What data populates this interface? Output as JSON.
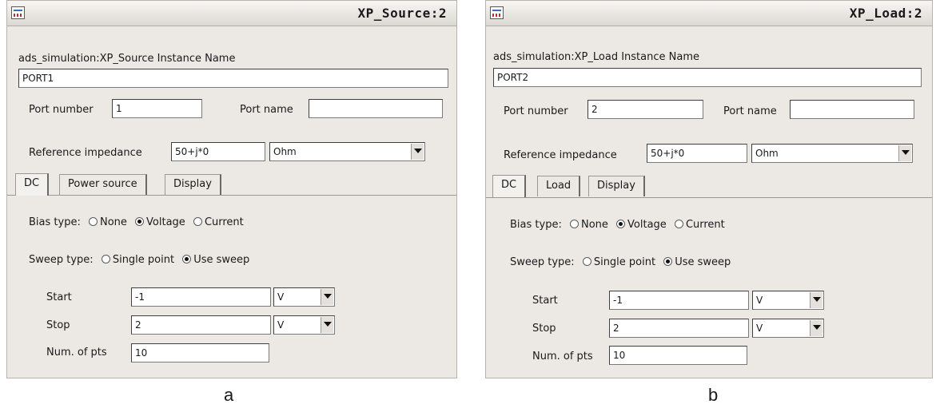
{
  "panel_a": {
    "title": "XP_Source:2",
    "instance_label": "ads_simulation:XP_Source Instance Name",
    "instance_value": "PORT1",
    "port_number_label": "Port number",
    "port_number_value": "1",
    "port_name_label": "Port name",
    "port_name_value": "",
    "ref_impedance_label": "Reference impedance",
    "ref_impedance_value": "50+j*0",
    "ref_impedance_unit": "Ohm",
    "tabs": [
      "DC",
      "Power source",
      "Display"
    ],
    "bias_label": "Bias type:",
    "bias_options": [
      "None",
      "Voltage",
      "Current"
    ],
    "sweep_label": "Sweep type:",
    "sweep_options": [
      "Single point",
      "Use sweep"
    ],
    "start_label": "Start",
    "start_value": "-1",
    "start_unit": "V",
    "stop_label": "Stop",
    "stop_value": "2",
    "stop_unit": "V",
    "num_pts_label": "Num. of pts",
    "num_pts_value": "10",
    "caption": "a"
  },
  "panel_b": {
    "title": "XP_Load:2",
    "instance_label": "ads_simulation:XP_Load Instance Name",
    "instance_value": "PORT2",
    "port_number_label": "Port number",
    "port_number_value": "2",
    "port_name_label": "Port name",
    "port_name_value": "",
    "ref_impedance_label": "Reference impedance",
    "ref_impedance_value": "50+j*0",
    "ref_impedance_unit": "Ohm",
    "tabs": [
      "DC",
      "Load",
      "Display"
    ],
    "bias_label": "Bias type:",
    "bias_options": [
      "None",
      "Voltage",
      "Current"
    ],
    "sweep_label": "Sweep type:",
    "sweep_options": [
      "Single point",
      "Use sweep"
    ],
    "start_label": "Start",
    "start_value": "-1",
    "start_unit": "V",
    "stop_label": "Stop",
    "stop_value": "2",
    "stop_unit": "V",
    "num_pts_label": "Num. of pts",
    "num_pts_value": "10",
    "caption": "b"
  },
  "selected": {
    "bias": "Voltage",
    "sweep": "Use sweep"
  }
}
